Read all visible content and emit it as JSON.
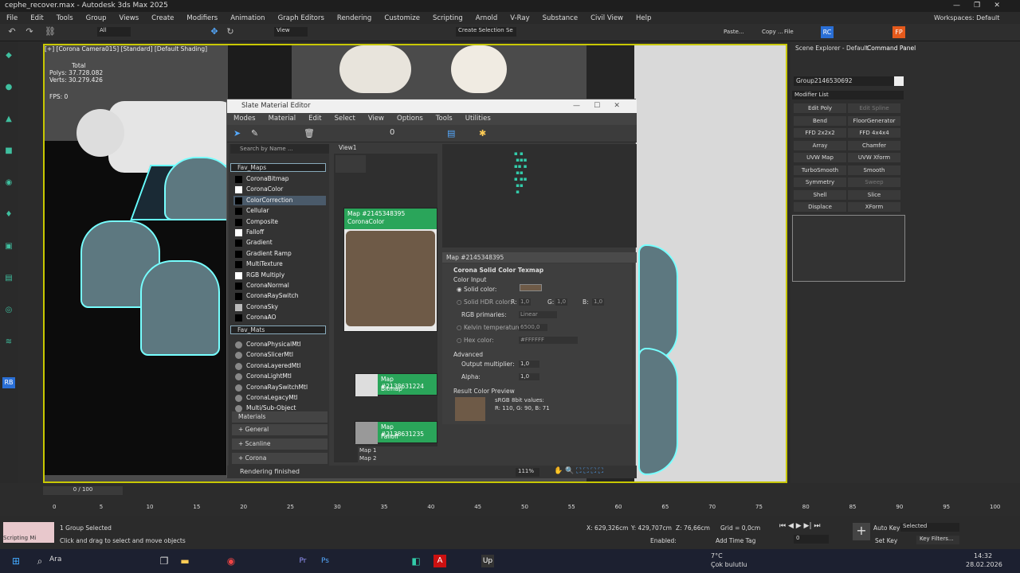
{
  "app": {
    "title": "cephe_recover.max - Autodesk 3ds Max 2025"
  },
  "menu": [
    "File",
    "Edit",
    "Tools",
    "Group",
    "Views",
    "Create",
    "Modifiers",
    "Animation",
    "Graph Editors",
    "Rendering",
    "Customize",
    "Scripting",
    "Arnold",
    "V-Ray",
    "Substance",
    "Civil View",
    "Help"
  ],
  "workspace": {
    "label": "Workspaces:",
    "value": "Default"
  },
  "toolbar": {
    "selection_filter": "All",
    "ref_coord": "View",
    "selection_set": "Create Selection Se",
    "paste": "Paste...",
    "copy": "Copy ...",
    "file": "File"
  },
  "viewport": {
    "label": "[+] [Corona Camera015] [Standard] [Default Shading]",
    "stats_total": "Total",
    "polys": "Polys:  37.728.082",
    "verts": "Verts:  30.279.426",
    "fps": "FPS:      0"
  },
  "sme": {
    "title": "Slate Material Editor",
    "menu": [
      "Modes",
      "Material",
      "Edit",
      "Select",
      "View",
      "Options",
      "Tools",
      "Utilities"
    ],
    "search_placeholder": "Search by Name ...",
    "view_tab": "View1",
    "fav_maps": "Fav_Maps",
    "maps": [
      "CoronaBitmap",
      "CoronaColor",
      "ColorCorrection",
      "Cellular",
      "Composite",
      "Falloff",
      "Gradient",
      "Gradient Ramp",
      "MultiTexture",
      "RGB Multiply",
      "CoronaNormal",
      "CoronaRaySwitch",
      "CoronaSky",
      "CoronaAO"
    ],
    "fav_mats": "Fav_Mats",
    "mats": [
      "CoronaPhysicalMtl",
      "CoronaSlicerMtl",
      "CoronaLayeredMtl",
      "CoronaLightMtl",
      "CoronaRaySwitchMtl",
      "CoronaLegacyMtl",
      "Multi/Sub-Object"
    ],
    "materials": "Materials",
    "groups": [
      "+ General",
      "+ Scanline",
      "+ Corona"
    ],
    "node1": {
      "name": "Map #2145348395",
      "type": "CoronaColor"
    },
    "node2": {
      "name": "Map #2138631224",
      "type": "Bitmap"
    },
    "node3": {
      "name": "Map #2138631235",
      "type": "Falloff"
    },
    "map1": "Map 1",
    "map2": "Map 2",
    "param_header": "Map #2145348395",
    "rollout": "Corona Solid Color Texmap",
    "color_input": "Color Input",
    "solid_color": "Solid color:",
    "solid_hdr": "Solid HDR color:",
    "r": "R:",
    "g": "G:",
    "b": "B:",
    "rv": "1,0",
    "gv": "1,0",
    "bv": "1,0",
    "rgb_primaries": "RGB primaries:",
    "rgb_primaries_val": "Linear",
    "kelvin": "Kelvin temperature:",
    "kelvin_val": "6500,0",
    "hex": "Hex color:",
    "hex_val": "#FFFFFF",
    "advanced": "Advanced",
    "output_mult": "Output multiplier:",
    "output_mult_val": "1,0",
    "alpha": "Alpha:",
    "alpha_val": "1,0",
    "result": "Result Color Preview",
    "srgb": "sRGB 8bit values:",
    "rgbvals": "R: 110, G: 90, B: 71",
    "swatch_color": "#6e5a47",
    "zoom": "111%",
    "status": "Rendering finished"
  },
  "panel": {
    "tab1": "Scene Explorer - Default",
    "tab2": "Command Panel",
    "object": "Group2146530692",
    "modlist": "Modifier List",
    "buttons": [
      "Edit Poly",
      "Edit Spline",
      "Bend",
      "FloorGenerator",
      "FFD 2x2x2",
      "FFD 4x4x4",
      "Array",
      "Chamfer",
      "UVW Map",
      "UVW Xform",
      "TurboSmooth",
      "Smooth",
      "Symmetry",
      "Sweep",
      "Shell",
      "Slice",
      "Displace",
      "XForm"
    ]
  },
  "timeline": {
    "frame": "0 / 100",
    "ticks": [
      "0",
      "5",
      "10",
      "15",
      "20",
      "25",
      "30",
      "35",
      "40",
      "45",
      "50",
      "55",
      "60",
      "65",
      "70",
      "75",
      "80",
      "85",
      "90",
      "95",
      "100"
    ]
  },
  "status": {
    "script": "Scripting Mi",
    "selected": "1 Group Selected",
    "hint": "Click and drag to select and move objects",
    "x": "X: 629,326cm",
    "y": "Y: 429,707cm",
    "z": "Z: 76,66cm",
    "grid": "Grid = 0,0cm",
    "enabled": "Enabled:",
    "addtime": "Add Time Tag",
    "autokey": "Auto Key",
    "setkey": "Set Key",
    "selected_dd": "Selected",
    "keyfilters": "Key Filters...",
    "frameval": "0"
  },
  "taskbar": {
    "search": "Ara",
    "weather_temp": "7°C",
    "weather": "Çok bulutlu",
    "time": "14:32",
    "date": "28.02.2026"
  }
}
